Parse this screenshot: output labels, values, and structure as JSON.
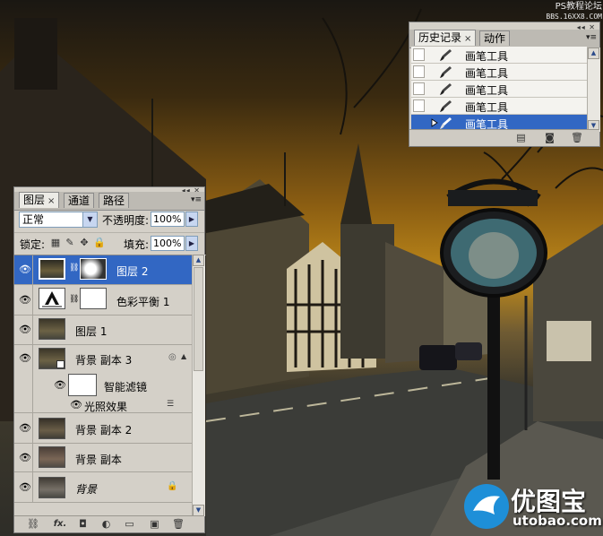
{
  "watermark_top": {
    "line1": "PS教程论坛",
    "line2": "BBS.16XX8.COM"
  },
  "watermark_bottom": {
    "brand": "优图宝",
    "url": "utobao.com"
  },
  "history_panel": {
    "tabs": [
      {
        "label": "历史记录",
        "active": true
      },
      {
        "label": "动作",
        "active": false
      }
    ],
    "close_glyph": "×",
    "menu_glyph": "▾≡",
    "items": [
      {
        "label": "画笔工具",
        "selected": false
      },
      {
        "label": "画笔工具",
        "selected": false
      },
      {
        "label": "画笔工具",
        "selected": false
      },
      {
        "label": "画笔工具",
        "selected": false
      },
      {
        "label": "画笔工具",
        "selected": true
      }
    ],
    "scroll_up": "▲",
    "scroll_down": "▼"
  },
  "layers_panel": {
    "tabs": [
      {
        "label": "图层",
        "active": true
      },
      {
        "label": "通道",
        "active": false
      },
      {
        "label": "路径",
        "active": false
      }
    ],
    "close_glyph": "×",
    "menu_glyph": "▾≡",
    "blend_mode": "正常",
    "opacity_label": "不透明度:",
    "opacity_value": "100%",
    "lock_label": "锁定:",
    "fill_label": "填充:",
    "fill_value": "100%",
    "layers": [
      {
        "name": "图层 2",
        "selected": true
      },
      {
        "name": "色彩平衡 1",
        "selected": false
      },
      {
        "name": "图层 1",
        "selected": false
      },
      {
        "name": "背景 副本 3",
        "selected": false
      },
      {
        "name": "智能滤镜",
        "selected": false
      },
      {
        "name": "光照效果",
        "selected": false
      },
      {
        "name": "背景 副本 2",
        "selected": false
      },
      {
        "name": "背景 副本",
        "selected": false
      },
      {
        "name": "背景",
        "selected": false
      }
    ],
    "fx_label": "fx."
  },
  "colors": {
    "selection": "#3267c3",
    "panel_bg": "#d4d0c8",
    "brand_blue": "#1e8fd8"
  }
}
